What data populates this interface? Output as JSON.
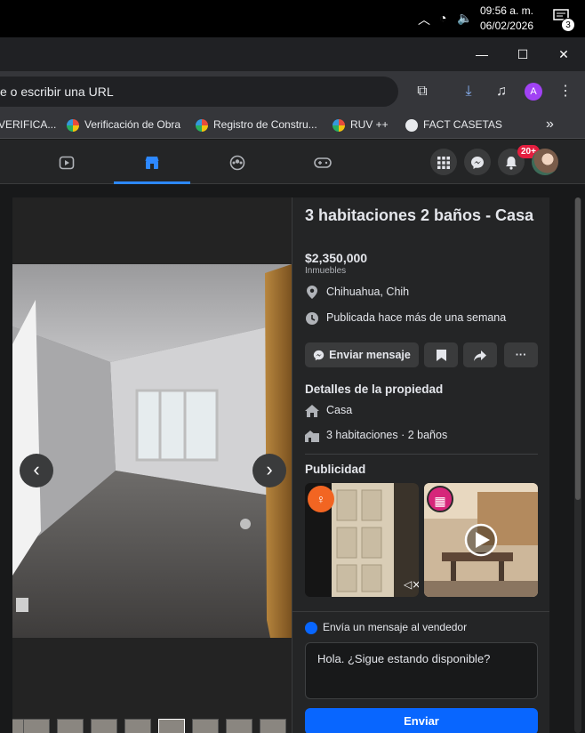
{
  "taskbar": {
    "time": "09:56 a. m.",
    "date": "06/02/2026",
    "notification_count": "3"
  },
  "window_controls": {
    "minimize": "—",
    "maximize": "☐",
    "close": "✕"
  },
  "toolbar": {
    "omnibox_text": "e o escribir una URL",
    "profile_initial": "A"
  },
  "bookmarks": [
    {
      "label": "VERIFICA..."
    },
    {
      "label": "Verificación de Obra"
    },
    {
      "label": "Registro de Constru..."
    },
    {
      "label": "RUV ++"
    },
    {
      "label": "FACT CASETAS"
    }
  ],
  "bookmarks_overflow": "»",
  "fb_nav": {
    "badge": "20+"
  },
  "listing": {
    "title": "3 habitaciones 2 baños - Casa",
    "price": "$2,350,000",
    "category": "Inmuebles",
    "location": "Chihuahua, Chih",
    "published": "Publicada hace más de una semana",
    "message_button": "Enviar mensaje",
    "details_title": "Detalles de la propiedad",
    "type": "Casa",
    "rooms": "3 habitaciones · 2 baños",
    "ads_title": "Publicidad"
  },
  "composer": {
    "header": "Envía un mensaje al vendedor",
    "message": "Hola. ¿Sigue estando disponible?",
    "send": "Enviar"
  },
  "colors": {
    "accent": "#2d88ff",
    "send_button": "#0866ff",
    "badge": "#e41e3f",
    "panel_bg": "#242526"
  }
}
